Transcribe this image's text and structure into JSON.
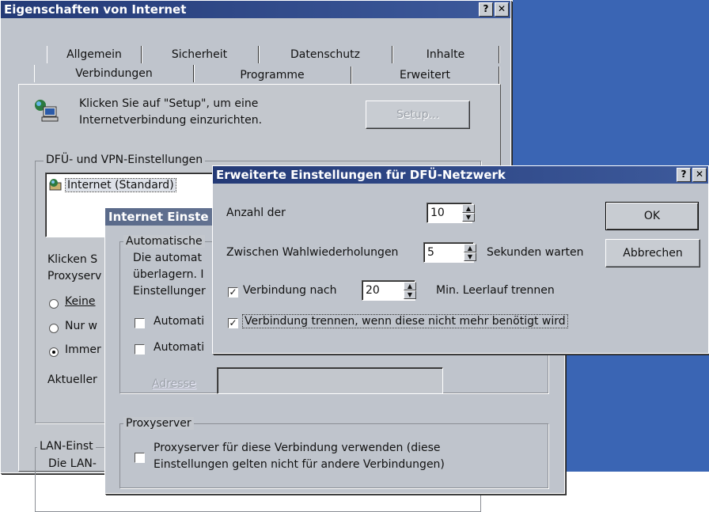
{
  "main_window": {
    "title": "Eigenschaften von Internet",
    "help_btn": "?",
    "close_btn": "✕",
    "tabs_row1": [
      "Allgemein",
      "Sicherheit",
      "Datenschutz",
      "Inhalte"
    ],
    "tabs_row2": [
      "Verbindungen",
      "Programme",
      "Erweitert"
    ],
    "setup_text_line1": "Klicken Sie auf \"Setup\", um eine",
    "setup_text_line2": "Internetverbindung einzurichten.",
    "setup_button": "Setup...",
    "dfu_group_label": "DFÜ- und VPN-Einstellungen",
    "connection_item": "Internet (Standard)",
    "klicken_partial_1": "Klicken S",
    "klicken_partial_2": "Proxyserv",
    "radio_keine": "Keine",
    "radio_nur": "Nur w",
    "radio_immer": "Immer",
    "aktueller": "Aktueller",
    "lan_group_label": "LAN-Einst",
    "lan_text": "Die LAN-"
  },
  "lan_window": {
    "title": "Internet Einste",
    "auto_group_label": "Automatische",
    "auto_text_1": "Die automat",
    "auto_text_2": "überlagern. I",
    "auto_text_3": "Einstellunger",
    "check1_label": "Automati",
    "check2_label": "Automati",
    "adresse_label": "Adresse",
    "proxy_group_label": "Proxyserver",
    "proxy_check_line1": "Proxyserver für diese Verbindung verwenden (diese",
    "proxy_check_line2": "Einstellungen gelten nicht für andere Verbindungen)"
  },
  "dfu_dialog": {
    "title": "Erweiterte Einstellungen für DFÜ-Netzwerk",
    "help_btn": "?",
    "close_btn": "✕",
    "anzahl_label": "Anzahl der",
    "anzahl_value": "10",
    "zwischen_label": "Zwischen Wahlwiederholungen",
    "zwischen_value": "5",
    "sekunden_label": "Sekunden warten",
    "verbindung_nach_label": "Verbindung nach",
    "verbindung_nach_value": "20",
    "min_leerlauf_label": "Min. Leerlauf trennen",
    "trennen_label": "Verbindung trennen, wenn diese nicht mehr benötigt wird",
    "ok_button": "OK",
    "cancel_button": "Abbrechen"
  }
}
